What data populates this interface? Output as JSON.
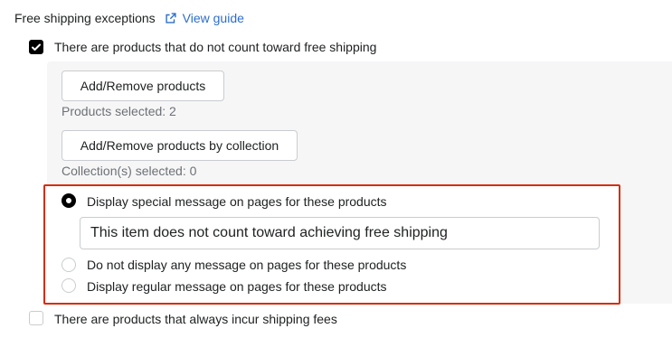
{
  "header": {
    "title": "Free shipping exceptions",
    "guide_link": "View guide"
  },
  "exceptions": {
    "no_count": {
      "label": "There are products that do not count toward free shipping",
      "checked": true
    },
    "always_fee": {
      "label": "There are products that always incur shipping fees",
      "checked": false
    }
  },
  "products": {
    "button_label": "Add/Remove products",
    "selected_text": "Products selected: 2"
  },
  "collections": {
    "button_label": "Add/Remove products by collection",
    "selected_text": "Collection(s) selected: 0"
  },
  "message_options": {
    "special": {
      "label": "Display special message on pages for these products",
      "selected": true
    },
    "message_value": "This item does not count toward achieving free shipping",
    "none": {
      "label": "Do not display any message on pages for these products",
      "selected": false
    },
    "regular": {
      "label": "Display regular message on pages for these products",
      "selected": false
    }
  },
  "colors": {
    "accent_link": "#2c6ecb",
    "highlight_border": "#d72c0d",
    "panel_bg": "#f6f6f7"
  }
}
